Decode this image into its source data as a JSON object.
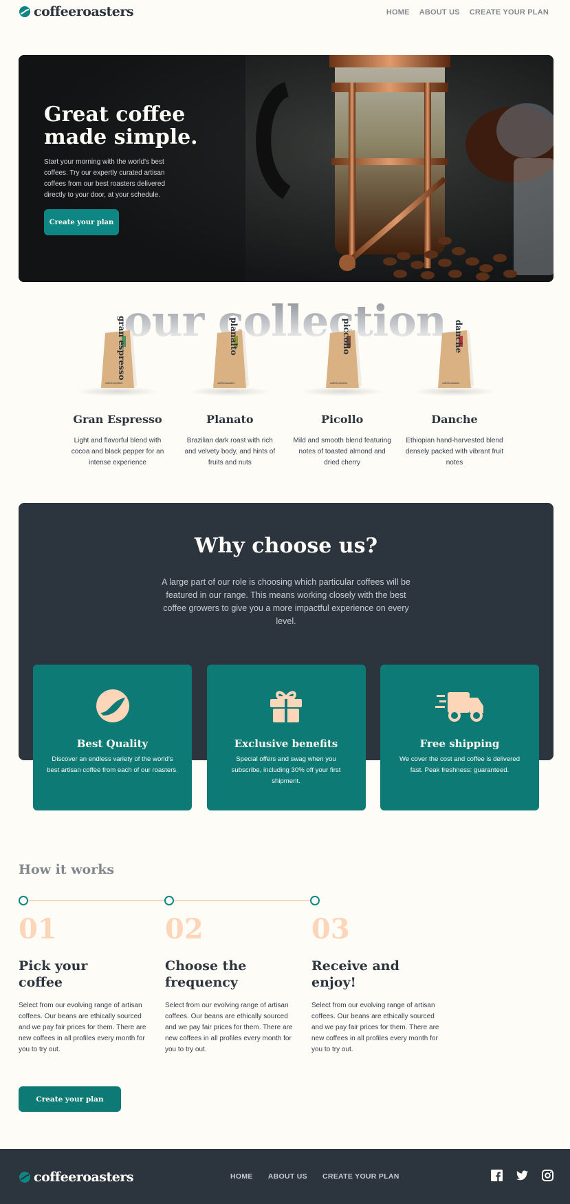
{
  "header": {
    "logo_text": "coffeeroasters",
    "nav": [
      "HOME",
      "ABOUT US",
      "CREATE YOUR PLAN"
    ]
  },
  "hero": {
    "title_line1": "Great coffee",
    "title_line2": "made simple.",
    "text": "Start your morning with the world's best coffees. Try our expertly curated artisan coffees from our best roasters delivered directly to your door, at your schedule.",
    "button": "Create your plan"
  },
  "collection": {
    "heading": "our collection",
    "products": [
      {
        "name": "Gran Espresso",
        "bag_label": "gran espresso",
        "accent": "#4e8f62",
        "desc": "Light and flavorful blend with cocoa and black pepper for an intense experience"
      },
      {
        "name": "Planato",
        "bag_label": "planalto",
        "accent": "#8c9a3e",
        "desc": "Brazilian dark roast with rich and velvety body, and hints of fruits and nuts"
      },
      {
        "name": "Picollo",
        "bag_label": "piccollo",
        "accent": "#7a4a3b",
        "desc": "Mild and smooth blend featuring notes of toasted almond and dried cherry"
      },
      {
        "name": "Danche",
        "bag_label": "danche",
        "accent": "#b8353d",
        "desc": "Ethiopian hand-harvested blend densely packed with vibrant fruit notes"
      }
    ]
  },
  "why": {
    "title": "Why choose us?",
    "text": "A large part of our role is choosing which particular coffees will be featured in our range. This means working closely with the best coffee growers to give you a more impactful experience on every level.",
    "cards": [
      {
        "icon": "coffee-bean-icon",
        "title": "Best Quality",
        "text": "Discover an endless variety of the world's best artisan coffee from each of our roasters."
      },
      {
        "icon": "gift-icon",
        "title": "Exclusive benefits",
        "text": "Special offers and swag when you subscribe, including 30% off your first shipment."
      },
      {
        "icon": "truck-icon",
        "title": "Free shipping",
        "text": "We cover the cost and coffee is delivered fast. Peak freshness: guaranteed."
      }
    ]
  },
  "how": {
    "title": "How it works",
    "steps": [
      {
        "num": "01",
        "title": "Pick your coffee",
        "text": "Select from our evolving range of artisan coffees. Our beans are ethically sourced and we pay fair prices for them. There are new coffees in all profiles every month for you to try out."
      },
      {
        "num": "02",
        "title": "Choose the frequency",
        "text": "Select from our evolving range of artisan coffees. Our beans are ethically sourced and we pay fair prices for them. There are new coffees in all profiles every month for you to try out."
      },
      {
        "num": "03",
        "title": "Receive and enjoy!",
        "text": "Select from our evolving range of artisan coffees. Our beans are ethically sourced and we pay fair prices for them. There are new coffees in all profiles every month for you to try out."
      }
    ],
    "button": "Create your plan"
  },
  "footer": {
    "logo_text": "coffeeroasters",
    "nav": [
      "HOME",
      "ABOUT US",
      "CREATE YOUR PLAN"
    ],
    "social": [
      "facebook-icon",
      "twitter-icon",
      "instagram-icon"
    ]
  },
  "colors": {
    "accent": "#0e8784",
    "dark": "#2c343e",
    "cream": "#fefcf7",
    "peach": "#fdd6ba"
  }
}
